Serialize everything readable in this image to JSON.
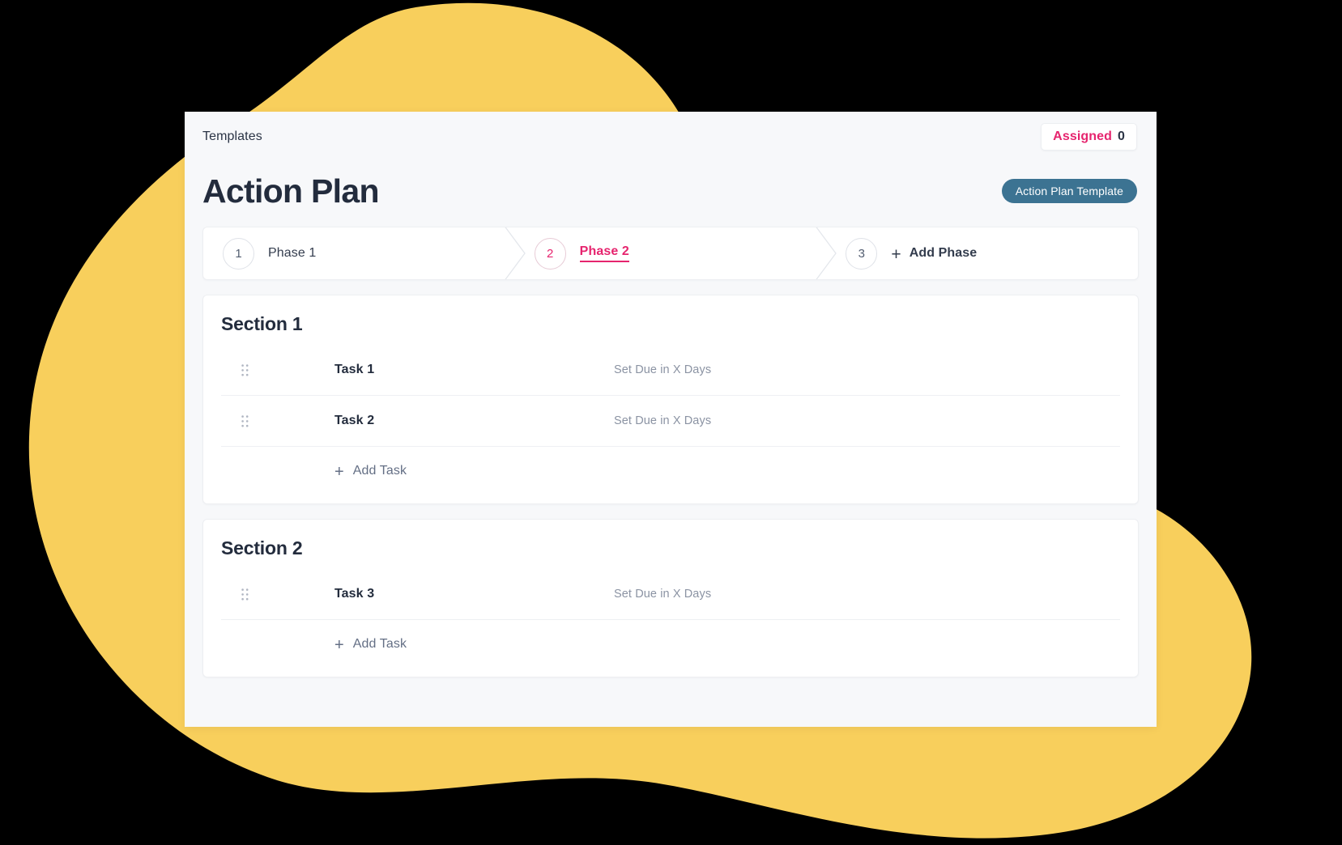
{
  "window": {
    "breadcrumb": "Templates",
    "assigned": {
      "label": "Assigned",
      "count": "0"
    },
    "title": "Action Plan",
    "template_badge": "Action Plan Template"
  },
  "stepper": {
    "phases": [
      {
        "number": "1",
        "label": "Phase 1",
        "active": false
      },
      {
        "number": "2",
        "label": "Phase 2",
        "active": true
      },
      {
        "number": "3",
        "label": "Add Phase",
        "active": false,
        "is_add": true
      }
    ],
    "add_phase_plus": "+"
  },
  "sections": [
    {
      "title": "Section 1",
      "tasks": [
        {
          "name": "Task 1",
          "due": "Set Due in X Days",
          "handle": "drag-handle-icon"
        },
        {
          "name": "Task 2",
          "due": "Set Due in X Days",
          "handle": "drag-handle-icon"
        }
      ],
      "add_task": {
        "plus": "+",
        "label": "Add Task"
      }
    },
    {
      "title": "Section 2",
      "tasks": [
        {
          "name": "Task 3",
          "due": "Set Due in X Days",
          "handle": "drag-handle-icon"
        }
      ],
      "add_task": {
        "plus": "+",
        "label": "Add Task"
      }
    }
  ],
  "colors": {
    "accent_pink": "#e6246e",
    "badge_blue": "#3c7392",
    "blob_yellow": "#f8cf5c",
    "text_dark": "#232c3d",
    "text_muted": "#8b93a3",
    "window_bg": "#f7f8fa",
    "page_bg": "#000000"
  }
}
